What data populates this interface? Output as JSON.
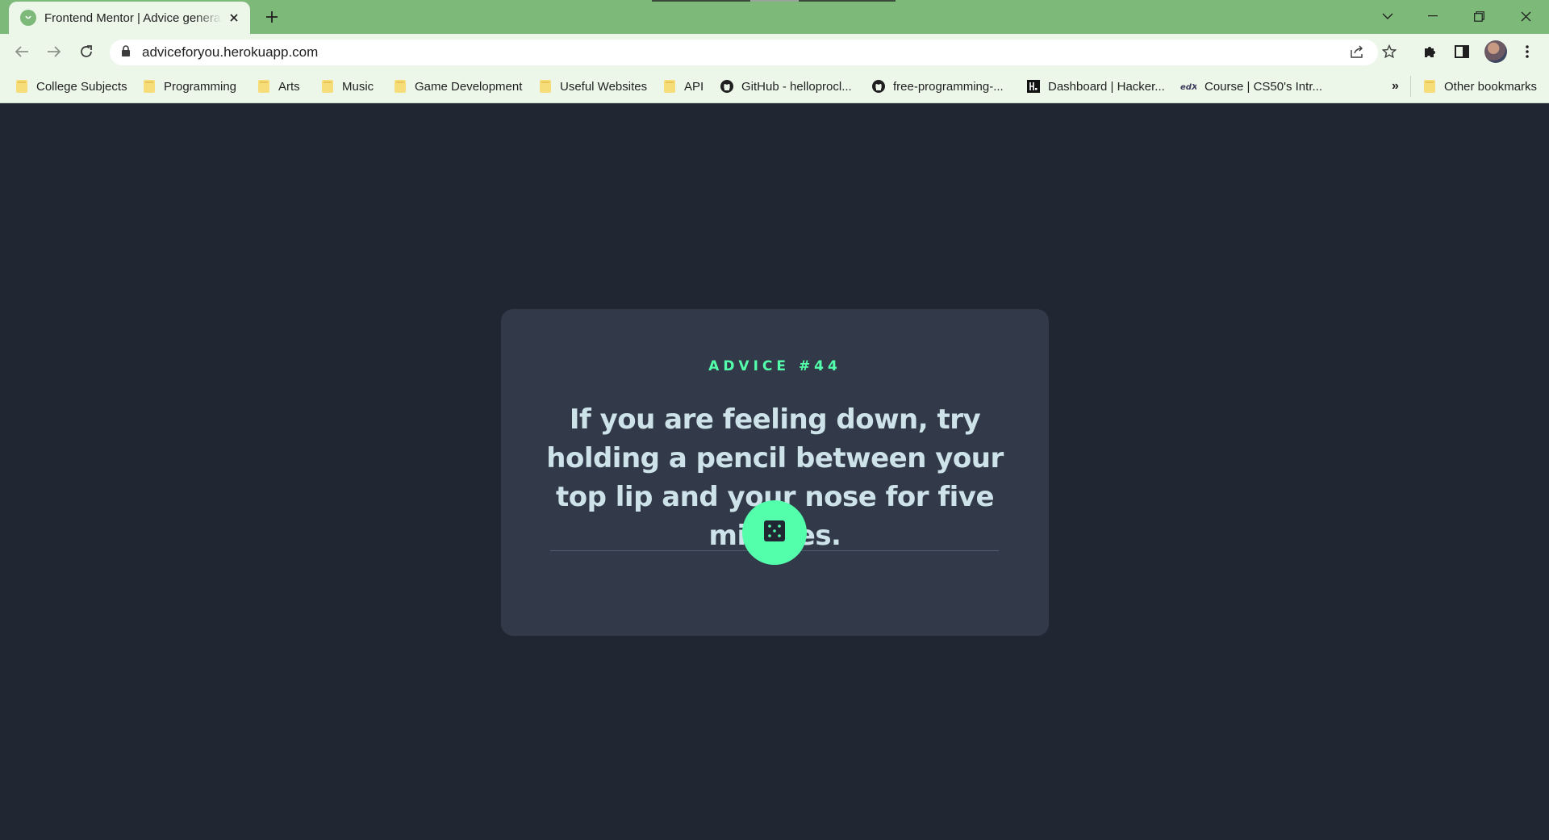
{
  "browser": {
    "tab": {
      "title": "Frontend Mentor | Advice generator app"
    },
    "address_bar": {
      "url": "adviceforyou.herokuapp.com"
    },
    "bookmarks": [
      {
        "label": "College Subjects",
        "icon": "folder-icon"
      },
      {
        "label": "Programming",
        "icon": "folder-icon"
      },
      {
        "label": "Arts",
        "icon": "folder-icon"
      },
      {
        "label": "Music",
        "icon": "folder-icon"
      },
      {
        "label": "Game Development",
        "icon": "folder-icon"
      },
      {
        "label": "Useful Websites",
        "icon": "folder-icon"
      },
      {
        "label": "API",
        "icon": "folder-icon"
      },
      {
        "label": "GitHub - helloprocl...",
        "icon": "github-icon"
      },
      {
        "label": "free-programming-...",
        "icon": "github-icon"
      },
      {
        "label": "Dashboard | Hacker...",
        "icon": "hackerrank-icon"
      },
      {
        "label": "Course | CS50's Intr...",
        "icon": "edx-icon"
      }
    ],
    "other_bookmarks": {
      "label": "Other bookmarks"
    },
    "overflow_label": "»"
  },
  "advice": {
    "heading": "ADVICE #44",
    "text": "If you are feeling down, try holding a pencil between your top lip and your nose for five minutes."
  },
  "colors": {
    "accent": "#53ffab",
    "page_bg": "#202632",
    "card_bg": "#323a49",
    "text_light": "#cee3e9",
    "chrome_green": "#7dba7a"
  }
}
